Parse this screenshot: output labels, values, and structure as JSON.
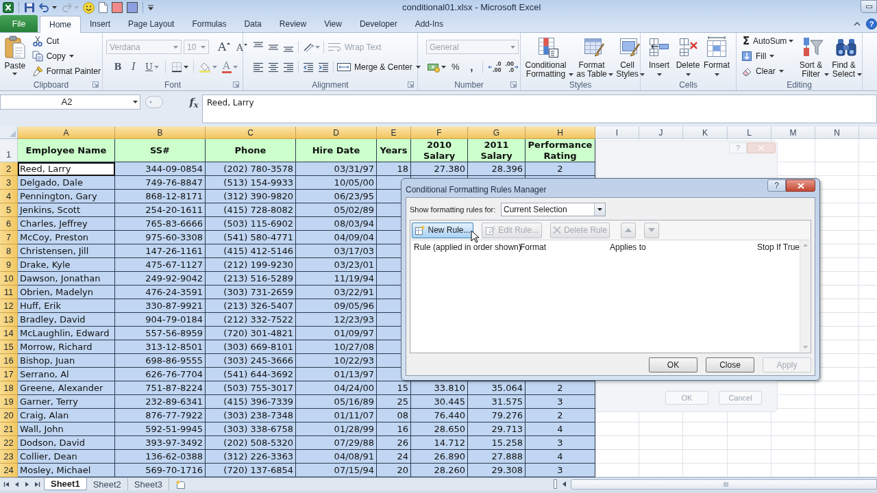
{
  "window": {
    "title": "conditional01.xlsx - Microsoft Excel"
  },
  "quick_access_toolbar": [
    {
      "kind": "app",
      "disabled": false
    },
    {
      "kind": "save",
      "disabled": false
    },
    {
      "kind": "undo",
      "disabled": false
    },
    {
      "kind": "redo",
      "disabled": true
    },
    {
      "kind": "smiley",
      "disabled": false
    },
    {
      "kind": "new",
      "disabled": false
    },
    {
      "kind": "swatch",
      "color": "#f08a8a",
      "disabled": false
    },
    {
      "kind": "swatch",
      "color": "#8d9fe0",
      "disabled": false
    },
    {
      "kind": "customize",
      "disabled": false
    }
  ],
  "ribbon_tabs": [
    {
      "label": "File",
      "kind": "file",
      "selected": false
    },
    {
      "label": "Home",
      "kind": "tab",
      "selected": true
    },
    {
      "label": "Insert",
      "kind": "tab",
      "selected": false
    },
    {
      "label": "Page Layout",
      "kind": "tab",
      "selected": false
    },
    {
      "label": "Formulas",
      "kind": "tab",
      "selected": false
    },
    {
      "label": "Data",
      "kind": "tab",
      "selected": false
    },
    {
      "label": "Review",
      "kind": "tab",
      "selected": false
    },
    {
      "label": "View",
      "kind": "tab",
      "selected": false
    },
    {
      "label": "Developer",
      "kind": "tab",
      "selected": false
    },
    {
      "label": "Add-Ins",
      "kind": "tab",
      "selected": false
    }
  ],
  "ribbon_help": "?",
  "ribbon": {
    "clipboard": {
      "label": "Clipboard",
      "paste": "Paste",
      "cut": "Cut",
      "copy": "Copy",
      "format_painter": "Format Painter"
    },
    "font": {
      "label": "Font",
      "font_name": {
        "value": "Verdana",
        "disabled": true
      },
      "font_size": {
        "value": "10",
        "disabled": true
      },
      "grow_font": "A",
      "shrink_font": "A",
      "bold": "B",
      "italic": "I",
      "underline": "U",
      "font_color": "A"
    },
    "alignment": {
      "label": "Alignment",
      "wrap_text": {
        "label": "Wrap Text",
        "disabled": true
      },
      "merge_center": {
        "label": "Merge & Center",
        "disabled": false
      }
    },
    "number": {
      "label": "Number",
      "number_format": {
        "value": "General",
        "disabled": true
      },
      "percent": "%",
      "comma": ",",
      "increase_decimal": [
        ".0",
        ".00"
      ],
      "decrease_decimal": [
        ".00",
        ".0"
      ]
    },
    "styles": {
      "label": "Styles",
      "buttons": [
        {
          "label": "Conditional Formatting",
          "kind": "conditional"
        },
        {
          "label": "Format as Table",
          "kind": "table"
        },
        {
          "label": "Cell Styles",
          "kind": "cell_styles"
        }
      ]
    },
    "cells": {
      "label": "Cells",
      "buttons": [
        {
          "label": "Insert",
          "kind": "insert"
        },
        {
          "label": "Delete",
          "kind": "delete"
        },
        {
          "label": "Format",
          "kind": "format"
        }
      ]
    },
    "editing": {
      "label": "Editing",
      "autosum": {
        "symbol": "Σ",
        "label": "AutoSum"
      },
      "fill": "Fill",
      "clear": "Clear",
      "buttons": [
        {
          "label": "Sort & Filter",
          "kind": "sort"
        },
        {
          "label": "Find & Select",
          "kind": "find"
        }
      ]
    }
  },
  "formula_bar": {
    "name_box": "A2",
    "function_label": "f$_{x}$",
    "formula": "Reed, Larry"
  },
  "columns": [
    {
      "label": "A",
      "selected": true
    },
    {
      "label": "B",
      "selected": true
    },
    {
      "label": "C",
      "selected": true
    },
    {
      "label": "D",
      "selected": true
    },
    {
      "label": "E",
      "selected": true
    },
    {
      "label": "F",
      "selected": true
    },
    {
      "label": "G",
      "selected": true
    },
    {
      "label": "H",
      "selected": true
    },
    {
      "label": "I",
      "selected": false
    },
    {
      "label": "J",
      "selected": false
    },
    {
      "label": "K",
      "selected": false
    },
    {
      "label": "L",
      "selected": false
    },
    {
      "label": "M",
      "selected": false
    },
    {
      "label": "N",
      "selected": false
    }
  ],
  "header_row": {
    "row": "1",
    "selected": false,
    "cells": [
      "Employee Name",
      "SS#",
      "Phone",
      "Hire Date",
      "Years",
      "2010 Salary",
      "2011 Salary",
      "Performance Rating"
    ]
  },
  "rows": [
    {
      "row": "2",
      "selected": true,
      "active": true,
      "cells": [
        "Reed, Larry",
        "344-09-0854",
        "(202) 780-3578",
        "03/31/97",
        "18",
        "27.380",
        "28.396",
        "2"
      ]
    },
    {
      "row": "3",
      "selected": true,
      "active": false,
      "cells": [
        "Delgado, Dale",
        "749-76-8847",
        "(513) 154-9933",
        "10/05/00"
      ]
    },
    {
      "row": "4",
      "selected": true,
      "active": false,
      "cells": [
        "Pennington, Gary",
        "868-12-8171",
        "(312) 390-9820",
        "06/23/95"
      ]
    },
    {
      "row": "5",
      "selected": true,
      "active": false,
      "cells": [
        "Jenkins, Scott",
        "254-20-1611",
        "(415) 728-8082",
        "05/02/89"
      ]
    },
    {
      "row": "6",
      "selected": true,
      "active": false,
      "cells": [
        "Charles, Jeffrey",
        "765-83-6666",
        "(503) 115-6902",
        "08/03/94"
      ]
    },
    {
      "row": "7",
      "selected": true,
      "active": false,
      "cells": [
        "McCoy, Preston",
        "975-60-3308",
        "(541) 580-4771",
        "04/09/04"
      ]
    },
    {
      "row": "8",
      "selected": true,
      "active": false,
      "cells": [
        "Christensen, Jill",
        "147-26-1161",
        "(415) 412-5146",
        "03/17/03"
      ]
    },
    {
      "row": "9",
      "selected": true,
      "active": false,
      "cells": [
        "Drake, Kyle",
        "475-67-1127",
        "(212) 199-9230",
        "03/23/01"
      ]
    },
    {
      "row": "10",
      "selected": true,
      "active": false,
      "cells": [
        "Dawson, Jonathan",
        "249-92-9042",
        "(213) 516-5289",
        "11/19/94"
      ]
    },
    {
      "row": "11",
      "selected": true,
      "active": false,
      "cells": [
        "Obrien, Madelyn",
        "476-24-3591",
        "(303) 731-2659",
        "03/22/91"
      ]
    },
    {
      "row": "12",
      "selected": true,
      "active": false,
      "cells": [
        "Huff, Erik",
        "330-87-9921",
        "(213) 326-5407",
        "09/05/96"
      ]
    },
    {
      "row": "13",
      "selected": true,
      "active": false,
      "cells": [
        "Bradley, David",
        "904-79-0184",
        "(212) 332-7522",
        "12/23/93"
      ]
    },
    {
      "row": "14",
      "selected": true,
      "active": false,
      "cells": [
        "McLaughlin, Edward",
        "557-56-8959",
        "(720) 301-4821",
        "01/09/97"
      ]
    },
    {
      "row": "15",
      "selected": true,
      "active": false,
      "cells": [
        "Morrow, Richard",
        "313-12-8501",
        "(303) 669-8101",
        "10/27/08"
      ]
    },
    {
      "row": "16",
      "selected": true,
      "active": false,
      "cells": [
        "Bishop, Juan",
        "698-86-9555",
        "(303) 245-3666",
        "10/22/93"
      ]
    },
    {
      "row": "17",
      "selected": true,
      "active": false,
      "cells": [
        "Serrano, Al",
        "626-76-7704",
        "(541) 644-3692",
        "01/13/97"
      ]
    },
    {
      "row": "18",
      "selected": true,
      "active": false,
      "cells": [
        "Greene, Alexander",
        "751-87-8224",
        "(503) 755-3017",
        "04/24/00",
        "15",
        "33.810",
        "35.064",
        "2"
      ]
    },
    {
      "row": "19",
      "selected": true,
      "active": false,
      "cells": [
        "Garner, Terry",
        "232-89-6341",
        "(415) 396-7339",
        "05/16/89",
        "25",
        "30.445",
        "31.575",
        "3"
      ]
    },
    {
      "row": "20",
      "selected": true,
      "active": false,
      "cells": [
        "Craig, Alan",
        "876-77-7922",
        "(303) 238-7348",
        "01/11/07",
        "08",
        "76.440",
        "79.276",
        "2"
      ]
    },
    {
      "row": "21",
      "selected": true,
      "active": false,
      "cells": [
        "Wall, John",
        "592-51-9945",
        "(303) 338-6758",
        "01/28/99",
        "16",
        "28.650",
        "29.713",
        "4"
      ]
    },
    {
      "row": "22",
      "selected": true,
      "active": false,
      "cells": [
        "Dodson, David",
        "393-97-3492",
        "(202) 508-5320",
        "07/29/88",
        "26",
        "14.712",
        "15.258",
        "3"
      ]
    },
    {
      "row": "23",
      "selected": true,
      "active": false,
      "cells": [
        "Collier, Dean",
        "136-62-0388",
        "(312) 226-3363",
        "04/08/91",
        "24",
        "26.890",
        "27.888",
        "4"
      ]
    },
    {
      "row": "24",
      "selected": true,
      "active": false,
      "cells": [
        "Mosley, Michael",
        "569-70-1716",
        "(720) 137-6854",
        "07/15/94",
        "20",
        "28.260",
        "29.308",
        "3"
      ]
    }
  ],
  "sheet_tabs": [
    {
      "label": "Sheet1",
      "selected": true
    },
    {
      "label": "Sheet2",
      "selected": false
    },
    {
      "label": "Sheet3",
      "selected": false
    }
  ],
  "background_dialog": {
    "help": "?",
    "buttons": [
      "OK",
      "Cancel"
    ]
  },
  "dialog": {
    "title": "Conditional Formatting Rules Manager",
    "help": "?",
    "scope_label": "Show formatting rules for:",
    "scope_value": "Current Selection",
    "toolbar": [
      {
        "kind": "new",
        "label": "New Rule...",
        "disabled": false,
        "hovered": true
      },
      {
        "kind": "edit",
        "label": "Edit Rule...",
        "disabled": true,
        "hovered": false
      },
      {
        "kind": "delete",
        "label": "Delete Rule",
        "disabled": true,
        "hovered": false
      },
      {
        "kind": "move_up",
        "disabled": true,
        "hovered": false
      },
      {
        "kind": "move_down",
        "disabled": true,
        "hovered": false
      }
    ],
    "columns": [
      "Rule (applied in order shown)",
      "Format",
      "Applies to",
      "Stop If True"
    ],
    "buttons": [
      {
        "label": "OK",
        "disabled": false
      },
      {
        "label": "Close",
        "disabled": false
      },
      {
        "label": "Apply",
        "disabled": true
      }
    ]
  }
}
